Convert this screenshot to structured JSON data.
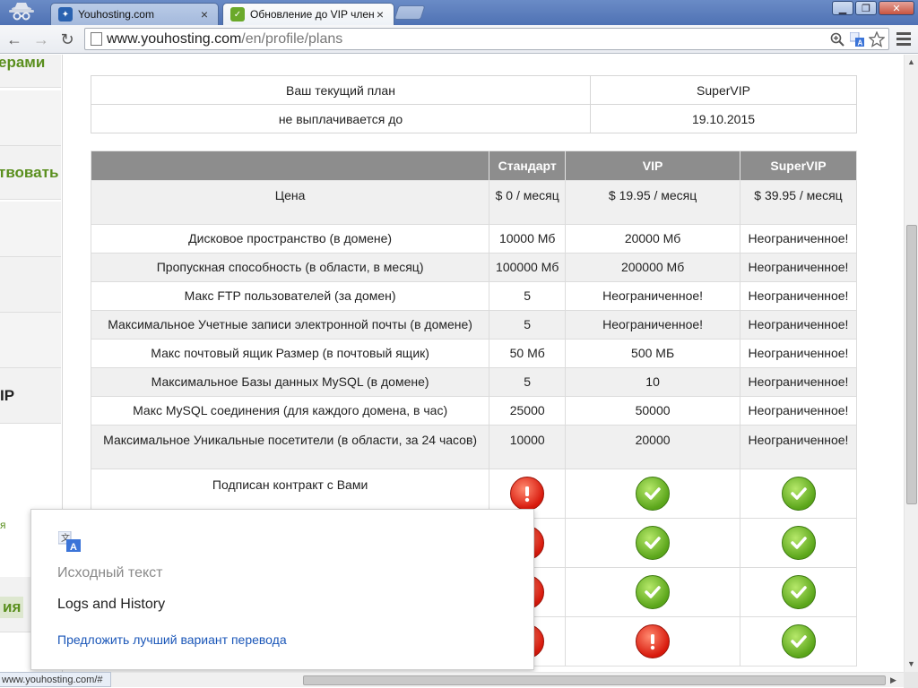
{
  "tabs": [
    {
      "title": "Youhosting.com",
      "active": false
    },
    {
      "title": "Обновление до VIP членст",
      "active": true
    }
  ],
  "window_controls": {
    "minimize": "▁",
    "maximize": "❐",
    "close": "✕"
  },
  "toolbar": {
    "back": "←",
    "forward": "→",
    "reload": "↻"
  },
  "address_bar": {
    "domain": "www.youhosting.com",
    "path": "/en/profile/plans"
  },
  "sidebar": {
    "links": [
      "ерами",
      "твовать",
      "IP",
      "я",
      "ия"
    ]
  },
  "current_plan": {
    "rows": [
      {
        "label": "Ваш текущий план",
        "value": "SuperVIP"
      },
      {
        "label": "не выплачивается до",
        "value": "19.10.2015"
      }
    ]
  },
  "plans_table": {
    "headers": [
      "",
      "Стандарт",
      "VIP",
      "SuperVIP"
    ],
    "rows": [
      {
        "feature": "Цена",
        "standard": "$ 0 / месяц",
        "vip": "$ 19.95 / месяц",
        "supervip": "$ 39.95 / месяц"
      },
      {
        "feature": "Дисковое пространство (в домене)",
        "standard": "10000 Мб",
        "vip": "20000 Мб",
        "supervip": "Неограниченное!"
      },
      {
        "feature": "Пропускная способность (в области, в месяц)",
        "standard": "100000 Мб",
        "vip": "200000 Мб",
        "supervip": "Неограниченное!"
      },
      {
        "feature": "Макс FTP пользователей (за домен)",
        "standard": "5",
        "vip": "Неограниченное!",
        "supervip": "Неограниченное!"
      },
      {
        "feature": "Максимальное Учетные записи электронной почты (в домене)",
        "standard": "5",
        "vip": "Неограниченное!",
        "supervip": "Неограниченное!"
      },
      {
        "feature": "Макс почтовый ящик Размер (в почтовый ящик)",
        "standard": "50 Мб",
        "vip": "500 МБ",
        "supervip": "Неограниченное!"
      },
      {
        "feature": "Максимальное Базы данных MySQL (в домене)",
        "standard": "5",
        "vip": "10",
        "supervip": "Неограниченное!"
      },
      {
        "feature": "Макс MySQL соединения (для каждого домена, в час)",
        "standard": "25000",
        "vip": "50000",
        "supervip": "Неограниченное!"
      },
      {
        "feature": "Максимальное Уникальные посетители (в области, за 24 часов)",
        "standard": "10000",
        "vip": "20000",
        "supervip": "Неограниченное!"
      }
    ],
    "icon_rows": [
      {
        "feature": "Подписан контракт с Вами",
        "standard": "no",
        "vip": "yes",
        "supervip": "yes"
      },
      {
        "feature": "",
        "standard": "no",
        "vip": "yes",
        "supervip": "yes"
      },
      {
        "feature": "",
        "standard": "no",
        "vip": "yes",
        "supervip": "yes"
      },
      {
        "feature": "",
        "standard": "no",
        "vip": "no",
        "supervip": "yes"
      }
    ]
  },
  "translate_popup": {
    "icon": "google-translate-icon",
    "original_label": "Исходный текст",
    "original_text": "Logs and History",
    "suggest_link": "Предложить лучший вариант перевода"
  },
  "status_bar": {
    "text": "www.youhosting.com/#"
  },
  "colors": {
    "accent_green": "#5a8f1e",
    "header_gray": "#8d8d8d",
    "link_blue": "#1a56b8",
    "ok_green": "#5aa51a",
    "no_red": "#d8190c"
  }
}
